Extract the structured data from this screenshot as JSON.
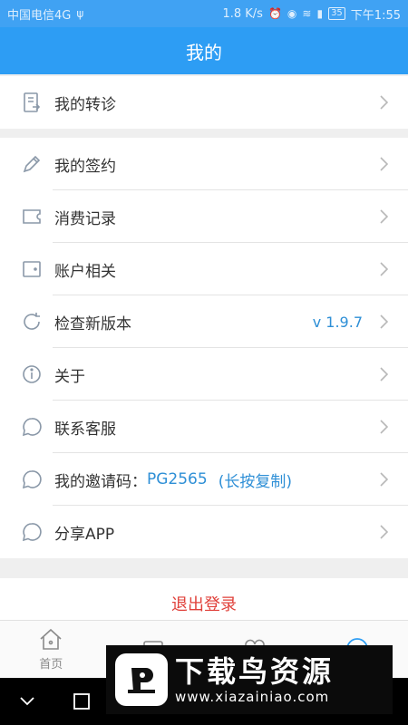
{
  "statusbar": {
    "carrier": "中国电信4G",
    "speed": "1.8 K/s",
    "battery": "35",
    "time": "下午1:55"
  },
  "header": {
    "title": "我的"
  },
  "menu": {
    "referral": "我的转诊",
    "contract": "我的签约",
    "consumption": "消费记录",
    "account": "账户相关",
    "update": "检查新版本",
    "update_version": "v 1.9.7",
    "about": "关于",
    "contact": "联系客服",
    "invite_label": "我的邀请码：",
    "invite_code": "PG2565",
    "invite_hint": "(长按复制)",
    "share": "分享APP"
  },
  "logout": "退出登录",
  "tabbar": {
    "home": "首页"
  },
  "watermark": {
    "title": "下载鸟资源",
    "url": "www.xiazainiao.com"
  },
  "colors": {
    "primary": "#2d9df4",
    "accent_text": "#2e8fd6",
    "logout": "#e0403a"
  }
}
